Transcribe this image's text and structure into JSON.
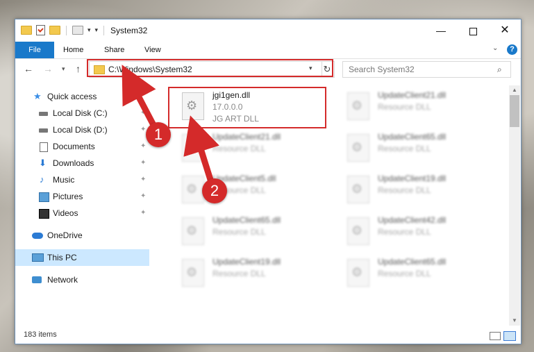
{
  "window": {
    "title": "System32",
    "controls": {
      "minimize": "—",
      "maximize": "",
      "close": "✕"
    }
  },
  "ribbon": {
    "tabs": [
      "File",
      "Home",
      "Share",
      "View"
    ],
    "help": "?"
  },
  "address_bar": {
    "path": "C:\\Windows\\System32",
    "search_placeholder": "Search System32"
  },
  "sidebar": {
    "items": [
      {
        "label": "Quick access",
        "icon": "star-icon",
        "pinned": false
      },
      {
        "label": "Local Disk (C:)",
        "icon": "disk-icon",
        "pinned": true
      },
      {
        "label": "Local Disk (D:)",
        "icon": "disk-icon",
        "pinned": true
      },
      {
        "label": "Documents",
        "icon": "documents-icon",
        "pinned": true
      },
      {
        "label": "Downloads",
        "icon": "downloads-icon",
        "pinned": true
      },
      {
        "label": "Music",
        "icon": "music-icon",
        "pinned": true
      },
      {
        "label": "Pictures",
        "icon": "pictures-icon",
        "pinned": true
      },
      {
        "label": "Videos",
        "icon": "videos-icon",
        "pinned": true
      },
      {
        "label": "OneDrive",
        "icon": "onedrive-icon",
        "pinned": false
      },
      {
        "label": "This PC",
        "icon": "this-pc-icon",
        "pinned": false,
        "selected": true
      },
      {
        "label": "Network",
        "icon": "network-icon",
        "pinned": false
      }
    ]
  },
  "files": [
    {
      "name": "jgi1gen.dll",
      "version": "17.0.0.0",
      "description": "JG ART DLL",
      "highlighted": true
    },
    {
      "name": "UpdateClient21.dll",
      "description": "Resource DLL"
    },
    {
      "name": "UpdateClient21.dll",
      "description": "Resource DLL"
    },
    {
      "name": "UpdateClient65.dll",
      "description": "Resource DLL"
    },
    {
      "name": "UpdateClient5.dll",
      "description": "Resource DLL"
    },
    {
      "name": "UpdateClient19.dll",
      "description": "Resource DLL"
    },
    {
      "name": "UpdateClient65.dll",
      "description": "Resource DLL"
    },
    {
      "name": "UpdateClient42.dll",
      "description": "Resource DLL"
    },
    {
      "name": "UpdateClient19.dll",
      "description": "Resource DLL"
    },
    {
      "name": "UpdateClient65.dll",
      "description": "Resource DLL"
    }
  ],
  "status": {
    "item_count": "183 items"
  },
  "annotations": {
    "step1": "1",
    "step2": "2",
    "color": "#d42a2a"
  }
}
